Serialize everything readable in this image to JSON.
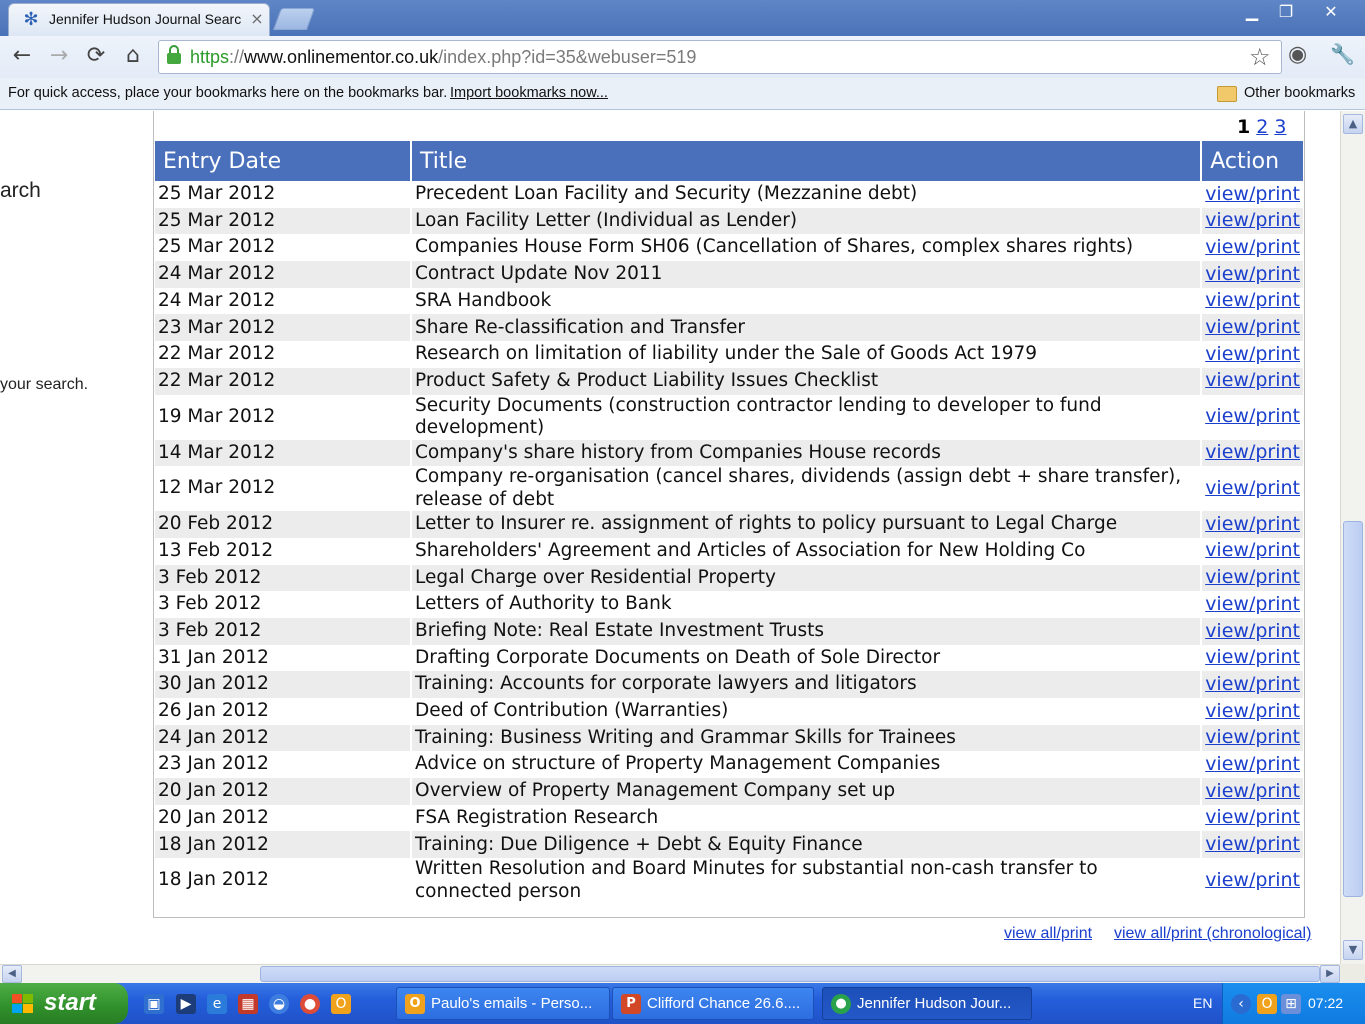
{
  "browser": {
    "tab_title": "Jennifer Hudson Journal Searc",
    "tab_close": "×",
    "window_controls": {
      "minimize": "▁",
      "restore": "❐",
      "close": "✕"
    },
    "nav": {
      "back": "←",
      "forward": "→",
      "reload": "⟳",
      "home": "⌂"
    },
    "url": {
      "scheme": "https",
      "sep": "://",
      "host": "www.onlinementor.co.uk",
      "path": "/index.php?id=35&webuser=519"
    },
    "star": "☆",
    "eye_icon": "◉",
    "wrench_icon": "🔧",
    "bookmarks_prompt": "For quick access, place your bookmarks here on the bookmarks bar.",
    "import_link": "Import bookmarks now...",
    "other_bookmarks": "Other bookmarks"
  },
  "sidebar_fragments": {
    "search_word": "arch",
    "your_search": "your search."
  },
  "pagination": {
    "current": "1",
    "pages": [
      "2",
      "3"
    ]
  },
  "table": {
    "headers": {
      "date": "Entry Date",
      "title": "Title",
      "action": "Action"
    },
    "rows": [
      {
        "date": "25 Mar 2012",
        "title": "Precedent Loan Facility and Security (Mezzanine debt)",
        "action": "view/print"
      },
      {
        "date": "25 Mar 2012",
        "title": "Loan Facility Letter (Individual as Lender)",
        "action": "view/print"
      },
      {
        "date": "25 Mar 2012",
        "title": "Companies House Form SH06 (Cancellation of Shares, complex shares rights)",
        "action": "view/print"
      },
      {
        "date": "24 Mar 2012",
        "title": "Contract Update Nov 2011",
        "action": "view/print"
      },
      {
        "date": "24 Mar 2012",
        "title": "SRA Handbook",
        "action": "view/print"
      },
      {
        "date": "23 Mar 2012",
        "title": "Share Re-classification and Transfer",
        "action": "view/print"
      },
      {
        "date": "22 Mar 2012",
        "title": "Research on limitation of liability under the Sale of Goods Act 1979",
        "action": "view/print"
      },
      {
        "date": "22 Mar 2012",
        "title": "Product Safety & Product Liability Issues Checklist",
        "action": "view/print"
      },
      {
        "date": "19 Mar 2012",
        "title": "Security Documents (construction contractor lending to developer to fund development)",
        "action": "view/print"
      },
      {
        "date": "14 Mar 2012",
        "title": "Company's share history from Companies House records",
        "action": "view/print"
      },
      {
        "date": "12 Mar 2012",
        "title": "Company re-organisation (cancel shares, dividends (assign debt + share transfer), release of debt",
        "action": "view/print"
      },
      {
        "date": "20 Feb 2012",
        "title": "Letter to Insurer re. assignment of rights to policy pursuant to Legal Charge",
        "action": "view/print"
      },
      {
        "date": "13 Feb 2012",
        "title": "Shareholders' Agreement and Articles of Association for New Holding Co",
        "action": "view/print"
      },
      {
        "date": "3 Feb 2012",
        "title": "Legal Charge over Residential Property",
        "action": "view/print"
      },
      {
        "date": "3 Feb 2012",
        "title": "Letters of Authority to Bank",
        "action": "view/print"
      },
      {
        "date": "3 Feb 2012",
        "title": "Briefing Note: Real Estate Investment Trusts",
        "action": "view/print"
      },
      {
        "date": "31 Jan 2012",
        "title": "Drafting Corporate Documents on Death of Sole Director",
        "action": "view/print"
      },
      {
        "date": "30 Jan 2012",
        "title": "Training: Accounts for corporate lawyers and litigators",
        "action": "view/print"
      },
      {
        "date": "26 Jan 2012",
        "title": "Deed of Contribution (Warranties)",
        "action": "view/print"
      },
      {
        "date": "24 Jan 2012",
        "title": "Training: Business Writing and Grammar Skills for Trainees",
        "action": "view/print"
      },
      {
        "date": "23 Jan 2012",
        "title": "Advice on structure of Property Management Companies",
        "action": "view/print"
      },
      {
        "date": "20 Jan 2012",
        "title": "Overview of Property Management Company set up",
        "action": "view/print"
      },
      {
        "date": "20 Jan 2012",
        "title": "FSA Registration Research",
        "action": "view/print"
      },
      {
        "date": "18 Jan 2012",
        "title": "Training: Due Diligence + Debt & Equity Finance",
        "action": "view/print"
      },
      {
        "date": "18 Jan 2012",
        "title": "Written Resolution and Board Minutes for substantial non-cash transfer to connected person",
        "action": "view/print"
      }
    ]
  },
  "footer_links": {
    "view_all": "view all/print",
    "view_all_chrono": "view all/print (chronological)"
  },
  "taskbar": {
    "start": "start",
    "windows": [
      {
        "icon": "O",
        "label": "Paulo's emails - Perso...",
        "icon_color": "#f0a21c"
      },
      {
        "icon": "P",
        "label": "Clifford Chance 26.6....",
        "icon_color": "#d24726"
      },
      {
        "icon": "●",
        "label": "Jennifer Hudson Jour...",
        "icon_color": "#2aa14b"
      }
    ],
    "language": "EN",
    "clock": "07:22"
  },
  "colors": {
    "header_blue": "#4a70bb",
    "link_blue": "#1a3fcc",
    "row_alt": "#ececec"
  }
}
